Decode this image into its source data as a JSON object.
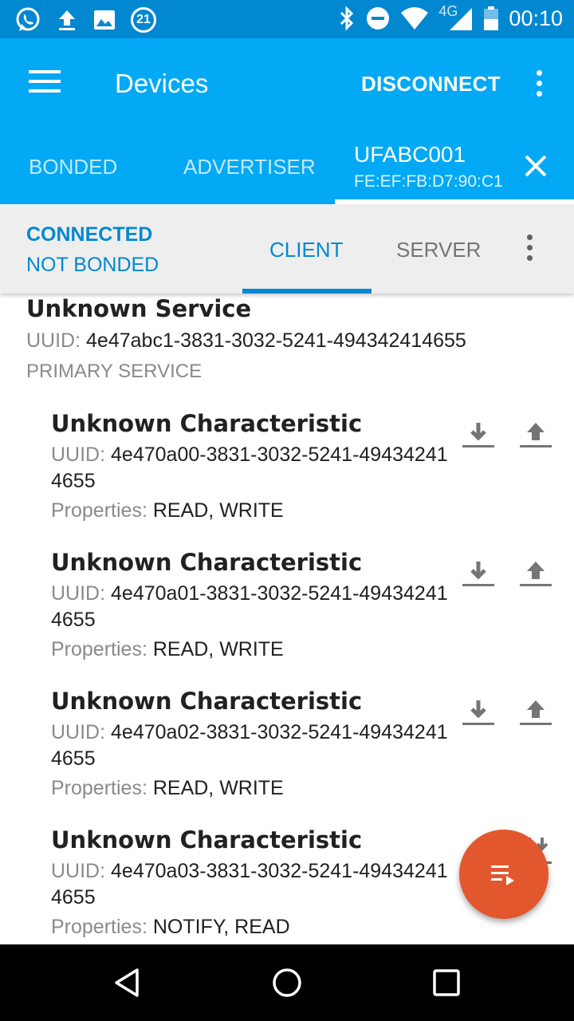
{
  "status_bar": {
    "notification_icons": [
      "whatsapp-icon",
      "upload-icon",
      "image-icon",
      "badge-21-icon"
    ],
    "badge_count": "21",
    "system_icons": [
      "bluetooth-icon",
      "do-not-disturb-icon",
      "wifi-icon",
      "cellular-4g-icon",
      "battery-icon"
    ],
    "network_label": "4G",
    "time": "00:10"
  },
  "app_bar": {
    "title": "Devices",
    "disconnect_label": "DISCONNECT",
    "tabs": [
      {
        "label": "BONDED"
      },
      {
        "label": "ADVERTISER"
      }
    ],
    "device_tab": {
      "name": "UFABC001",
      "address": "FE:EF:FB:D7:90:C1"
    }
  },
  "sub_bar": {
    "connection_status": "CONNECTED",
    "bond_status": "NOT BONDED",
    "tabs": [
      {
        "label": "CLIENT",
        "selected": true
      },
      {
        "label": "SERVER",
        "selected": false
      }
    ]
  },
  "service": {
    "name": "Unknown Service",
    "uuid_label": "UUID:",
    "uuid": "4e47abc1-3831-3032-5241-494342414655",
    "type": "PRIMARY SERVICE",
    "characteristics": [
      {
        "name": "Unknown Characteristic",
        "uuid_label": "UUID:",
        "uuid": "4e470a00-3831-3032-5241-494342414655",
        "props_label": "Properties:",
        "props": "READ, WRITE"
      },
      {
        "name": "Unknown Characteristic",
        "uuid_label": "UUID:",
        "uuid": "4e470a01-3831-3032-5241-494342414655",
        "props_label": "Properties:",
        "props": "READ, WRITE"
      },
      {
        "name": "Unknown Characteristic",
        "uuid_label": "UUID:",
        "uuid": "4e470a02-3831-3032-5241-494342414655",
        "props_label": "Properties:",
        "props": "READ, WRITE"
      },
      {
        "name": "Unknown Characteristic",
        "uuid_label": "UUID:",
        "uuid": "4e470a03-3831-3032-5241-494342414655",
        "props_label": "Properties:",
        "props": "NOTIFY, READ"
      }
    ]
  },
  "fab": {
    "icon": "playlist-play-icon"
  },
  "nav_bar": {
    "icons": [
      "back-icon",
      "home-icon",
      "recents-icon"
    ]
  },
  "colors": {
    "status_bar": "#0288d1",
    "app_bar": "#03a9f4",
    "accent": "#0288d1",
    "fab": "#e2572d",
    "sub_bar": "#eeeeee"
  }
}
